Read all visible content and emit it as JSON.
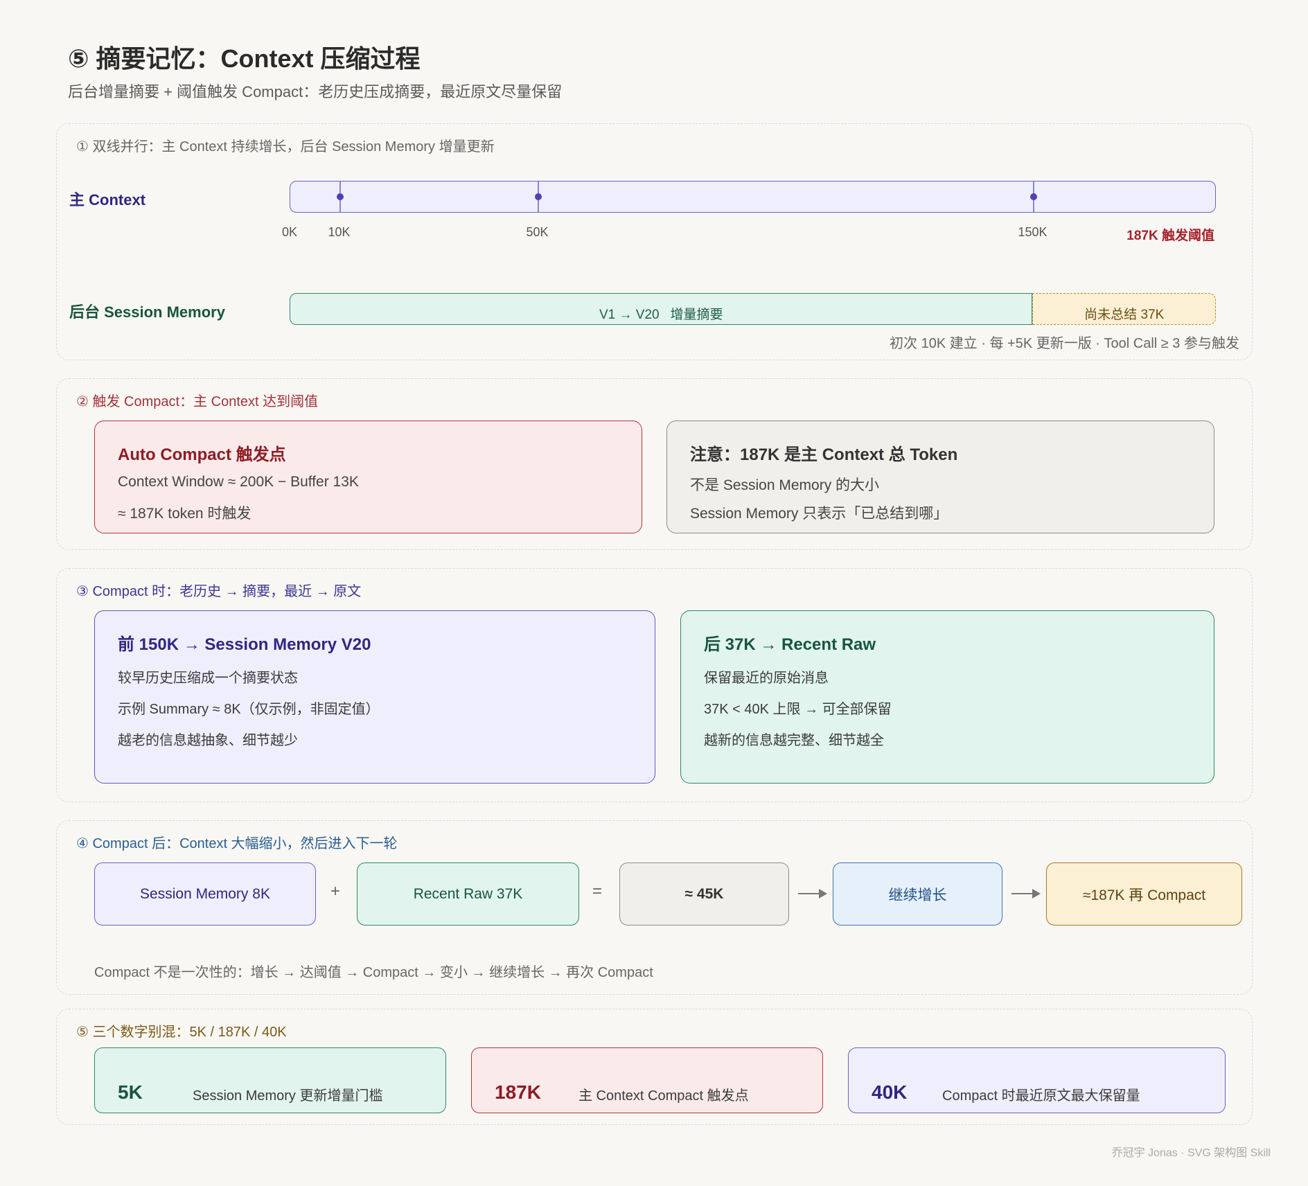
{
  "title": "⑤ 摘要记忆：Context 压缩过程",
  "subtitle": "后台增量摘要 + 阈值触发 Compact：老历史压成摘要，最近原文尽量保留",
  "section1": {
    "label": "① 双线并行：主 Context 持续增长，后台 Session Memory 增量更新",
    "main_label": "主 Context",
    "memory_label": "后台 Session Memory",
    "ticks": [
      "0K",
      "10K",
      "50K",
      "150K"
    ],
    "threshold_label": "187K 触发阈值",
    "memory_summary": "V1 → V20   增量摘要",
    "memory_pending": "尚未总结 37K",
    "memory_note": "初次 10K 建立 · 每 +5K 更新一版 · Tool Call ≥ 3 参与触发"
  },
  "section2": {
    "label": "② 触发 Compact：主 Context 达到阈值",
    "card_left": {
      "title": "Auto Compact 触发点",
      "lines": [
        "Context Window ≈ 200K − Buffer 13K",
        "≈ 187K token 时触发"
      ]
    },
    "card_right": {
      "title": "注意：187K 是主 Context 总 Token",
      "lines": [
        "不是 Session Memory 的大小",
        "Session Memory 只表示「已总结到哪」"
      ]
    }
  },
  "section3": {
    "label": "③ Compact 时：老历史 → 摘要，最近 → 原文",
    "card_left": {
      "title": "前 150K → Session Memory V20",
      "lines": [
        "较早历史压缩成一个摘要状态",
        "示例 Summary ≈ 8K（仅示例，非固定值）",
        "越老的信息越抽象、细节越少"
      ]
    },
    "card_right": {
      "title": "后 37K → Recent Raw",
      "lines": [
        "保留最近的原始消息",
        "37K < 40K 上限 → 可全部保留",
        "越新的信息越完整、细节越全"
      ]
    }
  },
  "section4": {
    "label": "④ Compact 后：Context 大幅缩小，然后进入下一轮",
    "boxes": [
      "Session Memory 8K",
      "Recent Raw 37K",
      "≈ 45K",
      "继续增长",
      "≈187K 再 Compact"
    ],
    "plus": "+",
    "equals": "=",
    "note": "Compact 不是一次性的：增长 → 达阈值 → Compact → 变小 → 继续增长 → 再次 Compact"
  },
  "section5": {
    "label": "⑤ 三个数字别混：5K / 187K / 40K",
    "items": [
      {
        "number": "5K",
        "desc": "Session Memory 更新增量门槛"
      },
      {
        "number": "187K",
        "desc": "主 Context Compact 触发点"
      },
      {
        "number": "40K",
        "desc": "Compact 时最近原文最大保留量"
      }
    ]
  },
  "footer": "乔冠宇 Jonas · SVG 架构图 Skill",
  "colors": {
    "main_track": "#6a62c2",
    "memory_green": "#2f8a67",
    "pending": "#b48a3a",
    "threshold_red": "#a4202a"
  },
  "chart_data": {
    "type": "bar",
    "main_context_ticks_k": [
      0,
      10,
      50,
      150
    ],
    "threshold_k": 187,
    "session_memory_summarized_k": 150,
    "session_memory_pending_k": 37,
    "axis_max_k": 187
  }
}
